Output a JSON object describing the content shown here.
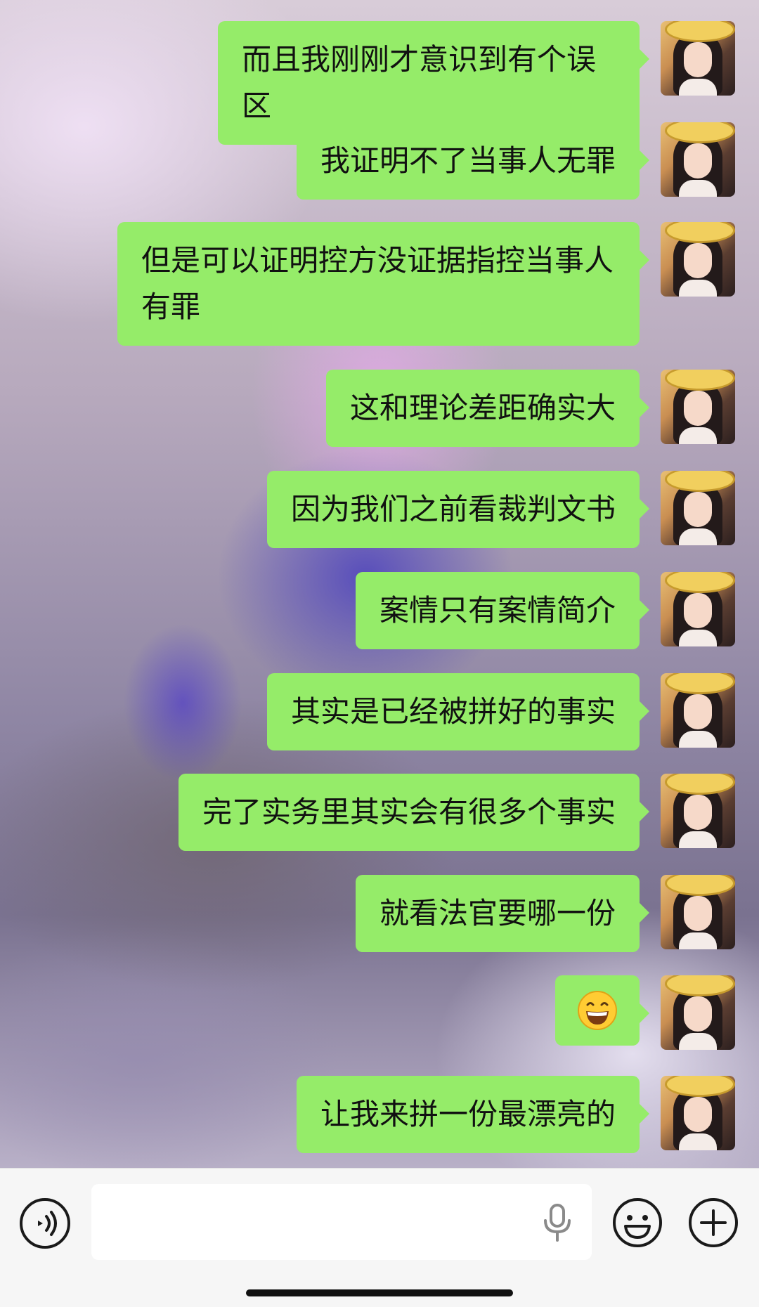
{
  "conversation": {
    "messages": [
      {
        "text": "而且我刚刚才意识到有个误区"
      },
      {
        "text": "我证明不了当事人无罪"
      },
      {
        "text": "但是可以证明控方没证据指控当事人有罪"
      },
      {
        "text": "这和理论差距确实大"
      },
      {
        "text": "因为我们之前看裁判文书"
      },
      {
        "text": "案情只有案情简介"
      },
      {
        "text": "其实是已经被拼好的事实"
      },
      {
        "text": "完了实务里其实会有很多个事实"
      },
      {
        "text": "就看法官要哪一份"
      },
      {
        "text": "",
        "emoji": "grinning-face-emoji"
      },
      {
        "text": "让我来拼一份最漂亮的"
      }
    ],
    "bubble_color": "#95ec69"
  },
  "input_bar": {
    "value": "",
    "icons": {
      "voice": "voice-mode-icon",
      "mic": "microphone-icon",
      "emoji": "emoji-icon",
      "plus": "plus-icon"
    }
  }
}
